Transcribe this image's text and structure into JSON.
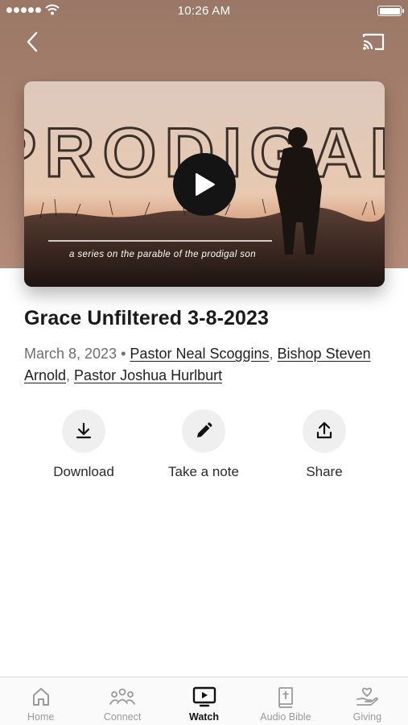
{
  "status_bar": {
    "time": "10:26 AM"
  },
  "artwork": {
    "series_title": "PRODIGAL",
    "tagline": "a series on the parable of the prodigal son"
  },
  "sermon": {
    "title": "Grace Unfiltered 3-8-2023",
    "date": "March 8, 2023",
    "separator": "•",
    "speakers": [
      "Pastor Neal Scoggins",
      "Bishop Steven Arnold",
      "Pastor Joshua Hurlburt"
    ]
  },
  "actions": [
    {
      "label": "Download",
      "icon": "download-icon"
    },
    {
      "label": "Take a note",
      "icon": "pencil-icon"
    },
    {
      "label": "Share",
      "icon": "share-icon"
    }
  ],
  "tabs": [
    {
      "label": "Home",
      "icon": "home-icon",
      "active": false
    },
    {
      "label": "Connect",
      "icon": "people-icon",
      "active": false
    },
    {
      "label": "Watch",
      "icon": "tv-play-icon",
      "active": true
    },
    {
      "label": "Audio Bible",
      "icon": "bible-icon",
      "active": false
    },
    {
      "label": "Giving",
      "icon": "heart-hand-icon",
      "active": false
    }
  ],
  "colors": {
    "header_background": "#a9826f",
    "active_tab": "#111111",
    "inactive_tab": "#9a9a9a"
  }
}
